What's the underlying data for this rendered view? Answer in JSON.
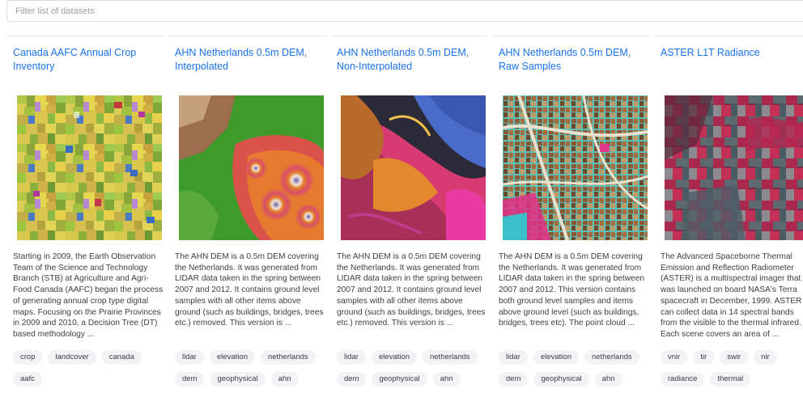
{
  "search": {
    "placeholder": "Filter list of datasets",
    "value": ""
  },
  "datasets": [
    {
      "title": "Canada AAFC Annual Crop Inventory",
      "description": "Starting in 2009, the Earth Observation Team of the Science and Technology Branch (STB) at Agriculture and Agri-Food Canada (AAFC) began the process of generating annual crop type digital maps. Focusing on the Prairie Provinces in 2009 and 2010, a Decision Tree (DT) based methodology ...",
      "tags": [
        "crop",
        "landcover",
        "canada",
        "aafc"
      ],
      "thumbnail": "crop-map-thumbnail"
    },
    {
      "title": "AHN Netherlands 0.5m DEM, Interpolated",
      "description": "The AHN DEM is a 0.5m DEM covering the Netherlands. It was generated from LIDAR data taken in the spring between 2007 and 2012. It contains ground level samples with all other items above ground (such as buildings, bridges, trees etc.) removed. This version is ...",
      "tags": [
        "lidar",
        "elevation",
        "netherlands",
        "dem",
        "geophysical",
        "ahn"
      ],
      "thumbnail": "dem-interpolated-thumbnail"
    },
    {
      "title": "AHN Netherlands 0.5m DEM, Non-Interpolated",
      "description": "The AHN DEM is a 0.5m DEM covering the Netherlands. It was generated from LIDAR data taken in the spring between 2007 and 2012. It contains ground level samples with all other items above ground (such as buildings, bridges, trees etc.) removed. This version is ...",
      "tags": [
        "lidar",
        "elevation",
        "netherlands",
        "dem",
        "geophysical",
        "ahn"
      ],
      "thumbnail": "dem-non-interpolated-thumbnail"
    },
    {
      "title": "AHN Netherlands 0.5m DEM, Raw Samples",
      "description": "The AHN DEM is a 0.5m DEM covering the Netherlands. It was generated from LIDAR data taken in the spring between 2007 and 2012. This version contains both ground level samples and items above ground level (such as buildings, bridges, trees etc). The point cloud ...",
      "tags": [
        "lidar",
        "elevation",
        "netherlands",
        "dem",
        "geophysical",
        "ahn"
      ],
      "thumbnail": "dem-raw-samples-thumbnail"
    },
    {
      "title": "ASTER L1T Radiance",
      "description": "The Advanced Spaceborne Thermal Emission and Reflection Radiometer (ASTER) is a multispectral imager that was launched on board NASA's Terra spacecraft in December, 1999. ASTER can collect data in 14 spectral bands from the visible to the thermal infrared. Each scene covers an area of ...",
      "tags": [
        "vnir",
        "tir",
        "swir",
        "nir",
        "radiance",
        "thermal"
      ],
      "thumbnail": "aster-radiance-thumbnail"
    }
  ],
  "colors": {
    "link": "#1a73e8",
    "chip_bg": "#f1f3f4",
    "border": "#dadce0"
  }
}
